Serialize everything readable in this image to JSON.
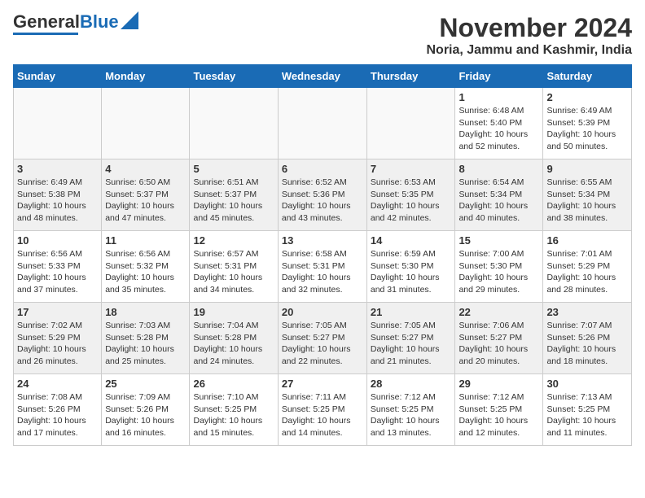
{
  "header": {
    "logo_general": "General",
    "logo_blue": "Blue",
    "month_title": "November 2024",
    "location": "Noria, Jammu and Kashmir, India"
  },
  "weekdays": [
    "Sunday",
    "Monday",
    "Tuesday",
    "Wednesday",
    "Thursday",
    "Friday",
    "Saturday"
  ],
  "weeks": [
    [
      {
        "day": "",
        "info": ""
      },
      {
        "day": "",
        "info": ""
      },
      {
        "day": "",
        "info": ""
      },
      {
        "day": "",
        "info": ""
      },
      {
        "day": "",
        "info": ""
      },
      {
        "day": "1",
        "info": "Sunrise: 6:48 AM\nSunset: 5:40 PM\nDaylight: 10 hours and 52 minutes."
      },
      {
        "day": "2",
        "info": "Sunrise: 6:49 AM\nSunset: 5:39 PM\nDaylight: 10 hours and 50 minutes."
      }
    ],
    [
      {
        "day": "3",
        "info": "Sunrise: 6:49 AM\nSunset: 5:38 PM\nDaylight: 10 hours and 48 minutes."
      },
      {
        "day": "4",
        "info": "Sunrise: 6:50 AM\nSunset: 5:37 PM\nDaylight: 10 hours and 47 minutes."
      },
      {
        "day": "5",
        "info": "Sunrise: 6:51 AM\nSunset: 5:37 PM\nDaylight: 10 hours and 45 minutes."
      },
      {
        "day": "6",
        "info": "Sunrise: 6:52 AM\nSunset: 5:36 PM\nDaylight: 10 hours and 43 minutes."
      },
      {
        "day": "7",
        "info": "Sunrise: 6:53 AM\nSunset: 5:35 PM\nDaylight: 10 hours and 42 minutes."
      },
      {
        "day": "8",
        "info": "Sunrise: 6:54 AM\nSunset: 5:34 PM\nDaylight: 10 hours and 40 minutes."
      },
      {
        "day": "9",
        "info": "Sunrise: 6:55 AM\nSunset: 5:34 PM\nDaylight: 10 hours and 38 minutes."
      }
    ],
    [
      {
        "day": "10",
        "info": "Sunrise: 6:56 AM\nSunset: 5:33 PM\nDaylight: 10 hours and 37 minutes."
      },
      {
        "day": "11",
        "info": "Sunrise: 6:56 AM\nSunset: 5:32 PM\nDaylight: 10 hours and 35 minutes."
      },
      {
        "day": "12",
        "info": "Sunrise: 6:57 AM\nSunset: 5:31 PM\nDaylight: 10 hours and 34 minutes."
      },
      {
        "day": "13",
        "info": "Sunrise: 6:58 AM\nSunset: 5:31 PM\nDaylight: 10 hours and 32 minutes."
      },
      {
        "day": "14",
        "info": "Sunrise: 6:59 AM\nSunset: 5:30 PM\nDaylight: 10 hours and 31 minutes."
      },
      {
        "day": "15",
        "info": "Sunrise: 7:00 AM\nSunset: 5:30 PM\nDaylight: 10 hours and 29 minutes."
      },
      {
        "day": "16",
        "info": "Sunrise: 7:01 AM\nSunset: 5:29 PM\nDaylight: 10 hours and 28 minutes."
      }
    ],
    [
      {
        "day": "17",
        "info": "Sunrise: 7:02 AM\nSunset: 5:29 PM\nDaylight: 10 hours and 26 minutes."
      },
      {
        "day": "18",
        "info": "Sunrise: 7:03 AM\nSunset: 5:28 PM\nDaylight: 10 hours and 25 minutes."
      },
      {
        "day": "19",
        "info": "Sunrise: 7:04 AM\nSunset: 5:28 PM\nDaylight: 10 hours and 24 minutes."
      },
      {
        "day": "20",
        "info": "Sunrise: 7:05 AM\nSunset: 5:27 PM\nDaylight: 10 hours and 22 minutes."
      },
      {
        "day": "21",
        "info": "Sunrise: 7:05 AM\nSunset: 5:27 PM\nDaylight: 10 hours and 21 minutes."
      },
      {
        "day": "22",
        "info": "Sunrise: 7:06 AM\nSunset: 5:27 PM\nDaylight: 10 hours and 20 minutes."
      },
      {
        "day": "23",
        "info": "Sunrise: 7:07 AM\nSunset: 5:26 PM\nDaylight: 10 hours and 18 minutes."
      }
    ],
    [
      {
        "day": "24",
        "info": "Sunrise: 7:08 AM\nSunset: 5:26 PM\nDaylight: 10 hours and 17 minutes."
      },
      {
        "day": "25",
        "info": "Sunrise: 7:09 AM\nSunset: 5:26 PM\nDaylight: 10 hours and 16 minutes."
      },
      {
        "day": "26",
        "info": "Sunrise: 7:10 AM\nSunset: 5:25 PM\nDaylight: 10 hours and 15 minutes."
      },
      {
        "day": "27",
        "info": "Sunrise: 7:11 AM\nSunset: 5:25 PM\nDaylight: 10 hours and 14 minutes."
      },
      {
        "day": "28",
        "info": "Sunrise: 7:12 AM\nSunset: 5:25 PM\nDaylight: 10 hours and 13 minutes."
      },
      {
        "day": "29",
        "info": "Sunrise: 7:12 AM\nSunset: 5:25 PM\nDaylight: 10 hours and 12 minutes."
      },
      {
        "day": "30",
        "info": "Sunrise: 7:13 AM\nSunset: 5:25 PM\nDaylight: 10 hours and 11 minutes."
      }
    ]
  ]
}
